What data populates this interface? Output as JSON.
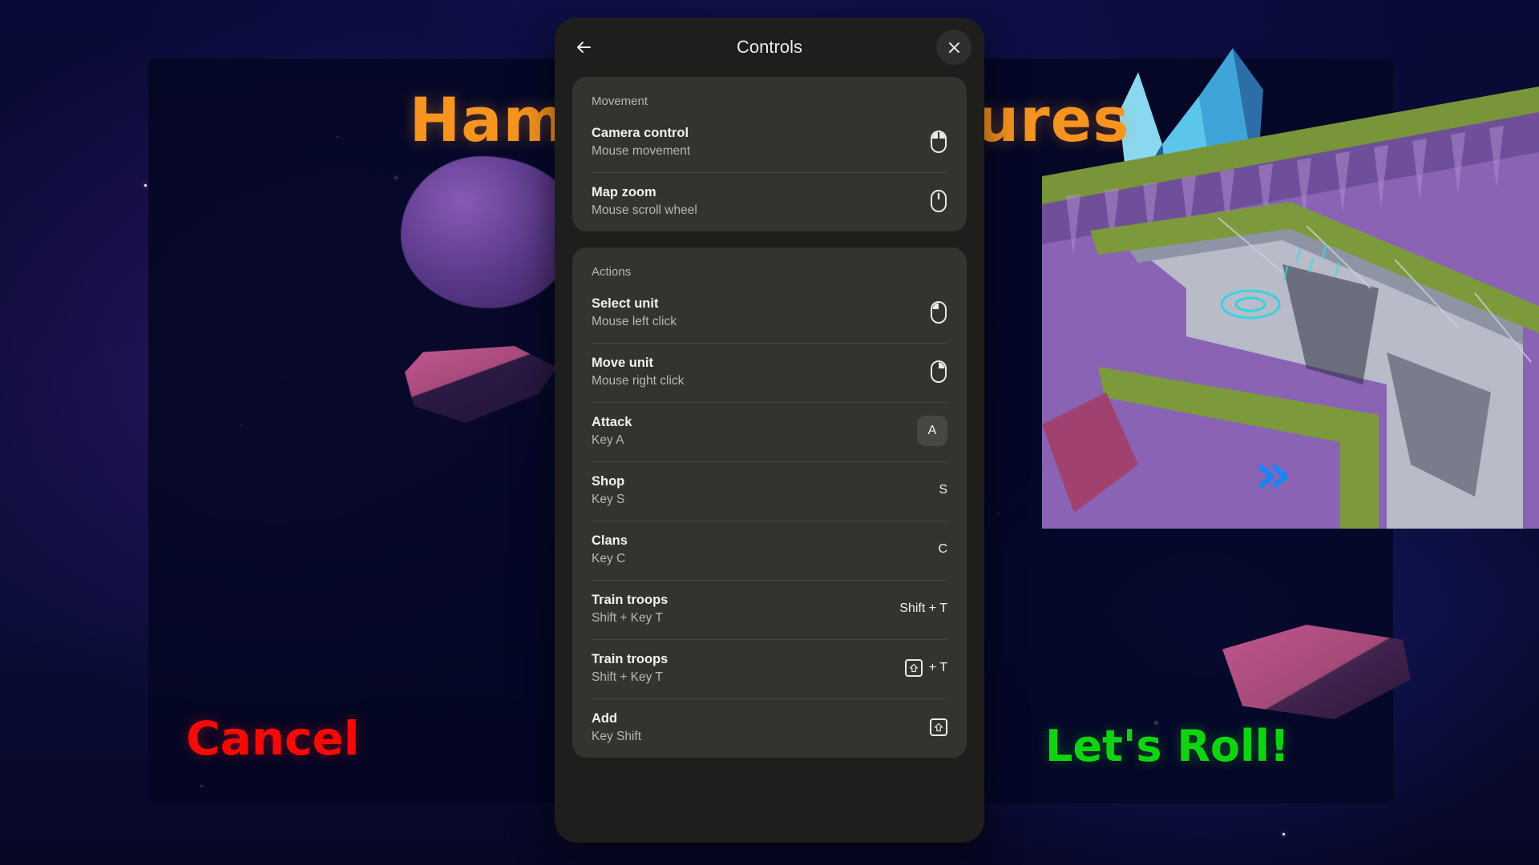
{
  "game": {
    "title": "Hammer Adventures",
    "cancel_label": "Cancel",
    "confirm_label": "Let's Roll!",
    "advance_icon": "double-chevron-right-icon",
    "colors": {
      "title": "#f79420",
      "cancel": "#f50a07",
      "confirm": "#11d411",
      "chevron": "#1a85f7"
    }
  },
  "dialog": {
    "title": "Controls",
    "back_icon": "arrow-left-icon",
    "close_icon": "close-icon",
    "background": "#1e1e1c",
    "card_background": "#33342f",
    "sections": [
      {
        "title": "Movement",
        "rows": [
          {
            "label": "Camera control",
            "sub": "Mouse movement",
            "binding_type": "icon",
            "binding_icon": "mouse-all-buttons-icon",
            "binding_text": ""
          },
          {
            "label": "Map zoom",
            "sub": "Mouse scroll wheel",
            "binding_type": "icon",
            "binding_icon": "mouse-scroll-wheel-icon",
            "binding_text": ""
          }
        ]
      },
      {
        "title": "Actions",
        "rows": [
          {
            "label": "Select unit",
            "sub": "Mouse left click",
            "binding_type": "icon",
            "binding_icon": "mouse-left-click-icon",
            "binding_text": ""
          },
          {
            "label": "Move unit",
            "sub": "Mouse right click",
            "binding_type": "icon",
            "binding_icon": "mouse-right-click-icon",
            "binding_text": ""
          },
          {
            "label": "Attack",
            "sub": "Key A",
            "binding_type": "keycap",
            "binding_icon": "",
            "binding_text": "A"
          },
          {
            "label": "Shop",
            "sub": "Key S",
            "binding_type": "text",
            "binding_icon": "",
            "binding_text": "S"
          },
          {
            "label": "Clans",
            "sub": "Key C",
            "binding_type": "text",
            "binding_icon": "",
            "binding_text": "C"
          },
          {
            "label": "Train troops",
            "sub": "Shift + Key T",
            "binding_type": "text",
            "binding_icon": "",
            "binding_text": "Shift + T"
          },
          {
            "label": "Train troops",
            "sub": "Shift + Key T",
            "binding_type": "shift-plus",
            "binding_icon": "shift-key-icon",
            "binding_text": "+ T"
          },
          {
            "label": "Add",
            "sub": "Key Shift",
            "binding_type": "shift-only",
            "binding_icon": "shift-key-icon",
            "binding_text": ""
          }
        ]
      }
    ]
  }
}
